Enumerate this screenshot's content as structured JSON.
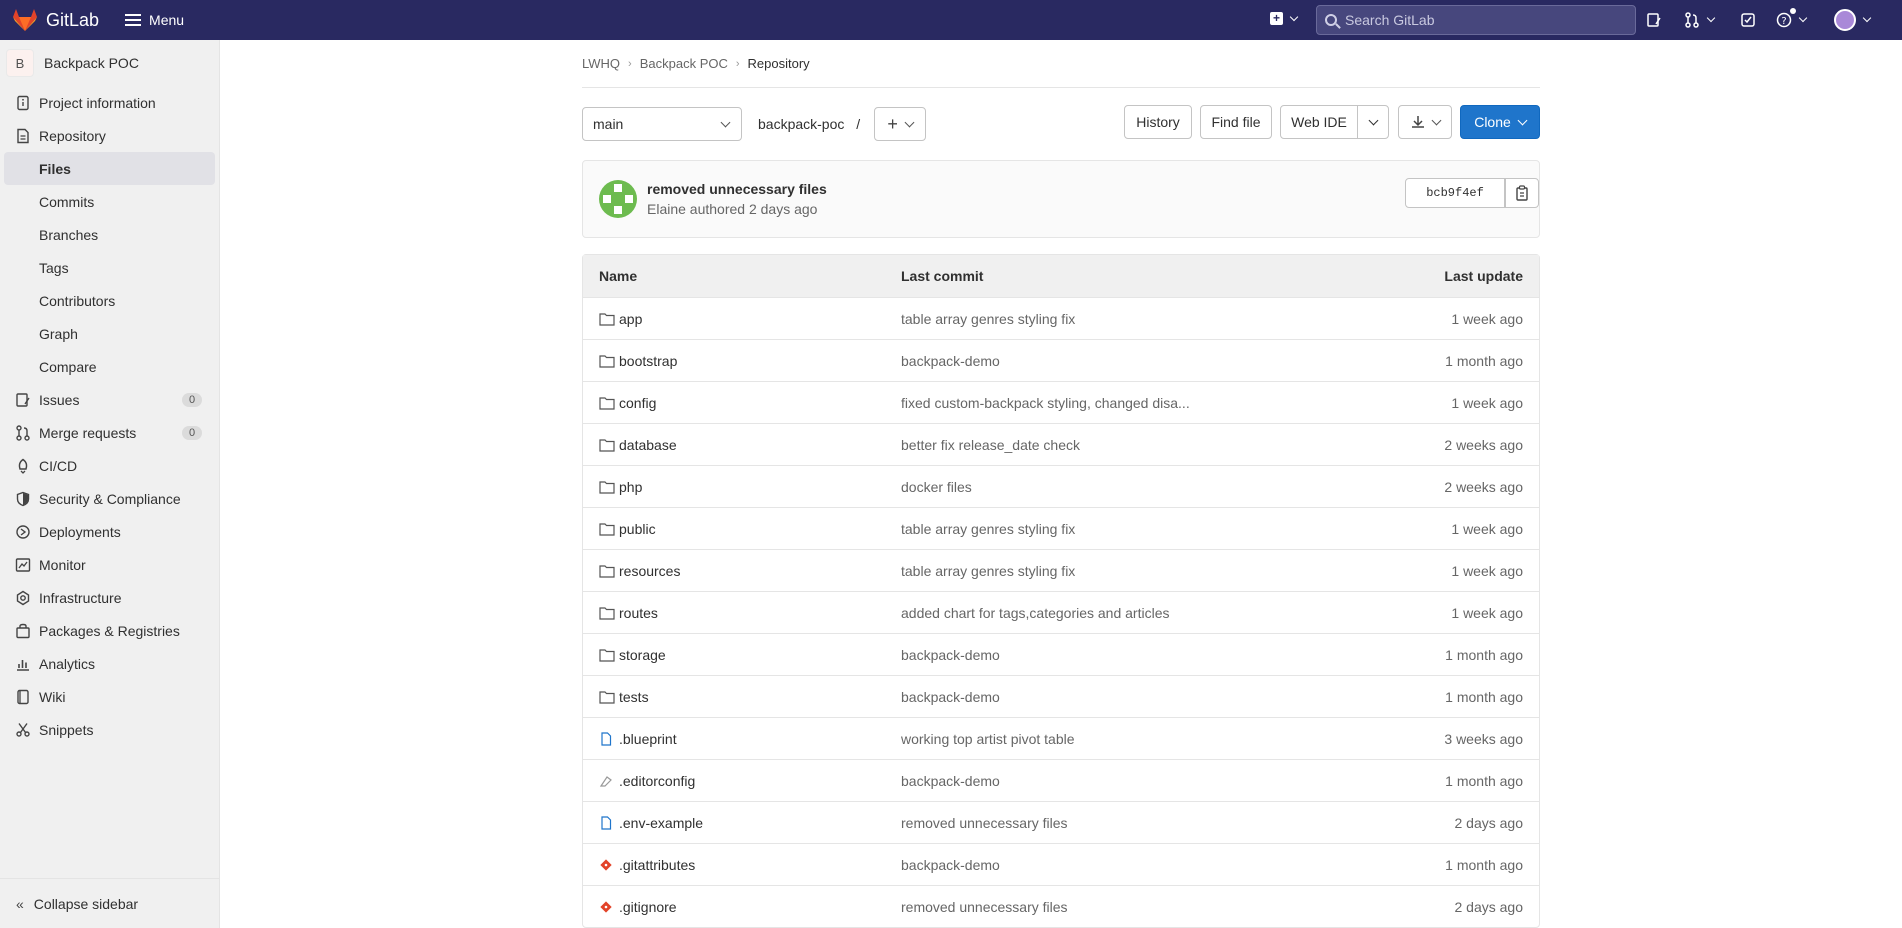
{
  "topbar": {
    "brand": "GitLab",
    "menu_label": "Menu",
    "search_placeholder": "Search GitLab"
  },
  "sidebar": {
    "project_initial": "B",
    "project_name": "Backpack POC",
    "items": [
      {
        "label": "Project information",
        "icon": "info-icon"
      },
      {
        "label": "Repository",
        "icon": "document-icon"
      },
      {
        "label": "Files",
        "sub": true,
        "active": true
      },
      {
        "label": "Commits",
        "sub": true
      },
      {
        "label": "Branches",
        "sub": true
      },
      {
        "label": "Tags",
        "sub": true
      },
      {
        "label": "Contributors",
        "sub": true
      },
      {
        "label": "Graph",
        "sub": true
      },
      {
        "label": "Compare",
        "sub": true
      },
      {
        "label": "Issues",
        "icon": "issues-icon",
        "count": "0"
      },
      {
        "label": "Merge requests",
        "icon": "merge-request-icon",
        "count": "0"
      },
      {
        "label": "CI/CD",
        "icon": "rocket-icon"
      },
      {
        "label": "Security & Compliance",
        "icon": "shield-icon"
      },
      {
        "label": "Deployments",
        "icon": "deployments-icon"
      },
      {
        "label": "Monitor",
        "icon": "monitor-icon"
      },
      {
        "label": "Infrastructure",
        "icon": "cloud-icon"
      },
      {
        "label": "Packages & Registries",
        "icon": "package-icon"
      },
      {
        "label": "Analytics",
        "icon": "chart-icon"
      },
      {
        "label": "Wiki",
        "icon": "book-icon"
      },
      {
        "label": "Snippets",
        "icon": "snippet-icon"
      }
    ],
    "collapse_label": "Collapse sidebar"
  },
  "breadcrumb": [
    "LWHQ",
    "Backpack POC",
    "Repository"
  ],
  "toolbar": {
    "branch": "main",
    "path": "backpack-poc",
    "path_sep": "/",
    "history": "History",
    "find_file": "Find file",
    "web_ide": "Web IDE",
    "clone": "Clone"
  },
  "last_commit": {
    "title": "removed unnecessary files",
    "meta": "Elaine authored 2 days ago",
    "sha": "bcb9f4ef"
  },
  "table": {
    "headers": {
      "name": "Name",
      "commit": "Last commit",
      "update": "Last update"
    },
    "rows": [
      {
        "name": "app",
        "type": "folder",
        "commit": "table array genres styling fix",
        "update": "1 week ago"
      },
      {
        "name": "bootstrap",
        "type": "folder",
        "commit": "backpack-demo",
        "update": "1 month ago"
      },
      {
        "name": "config",
        "type": "folder",
        "commit": "fixed custom-backpack styling, changed disa...",
        "update": "1 week ago"
      },
      {
        "name": "database",
        "type": "folder",
        "commit": "better fix release_date check",
        "update": "2 weeks ago"
      },
      {
        "name": "php",
        "type": "folder",
        "commit": "docker files",
        "update": "2 weeks ago"
      },
      {
        "name": "public",
        "type": "folder",
        "commit": "table array genres styling fix",
        "update": "1 week ago"
      },
      {
        "name": "resources",
        "type": "folder",
        "commit": "table array genres styling fix",
        "update": "1 week ago"
      },
      {
        "name": "routes",
        "type": "folder",
        "commit": "added chart for tags,categories and articles",
        "update": "1 week ago"
      },
      {
        "name": "storage",
        "type": "folder",
        "commit": "backpack-demo",
        "update": "1 month ago"
      },
      {
        "name": "tests",
        "type": "folder",
        "commit": "backpack-demo",
        "update": "1 month ago"
      },
      {
        "name": ".blueprint",
        "type": "file",
        "commit": "working top artist pivot table",
        "update": "3 weeks ago"
      },
      {
        "name": ".editorconfig",
        "type": "editorconfig",
        "commit": "backpack-demo",
        "update": "1 month ago"
      },
      {
        "name": ".env-example",
        "type": "file",
        "commit": "removed unnecessary files",
        "update": "2 days ago"
      },
      {
        "name": ".gitattributes",
        "type": "git",
        "commit": "backpack-demo",
        "update": "1 month ago"
      },
      {
        "name": ".gitignore",
        "type": "git",
        "commit": "removed unnecessary files",
        "update": "2 days ago"
      }
    ]
  }
}
